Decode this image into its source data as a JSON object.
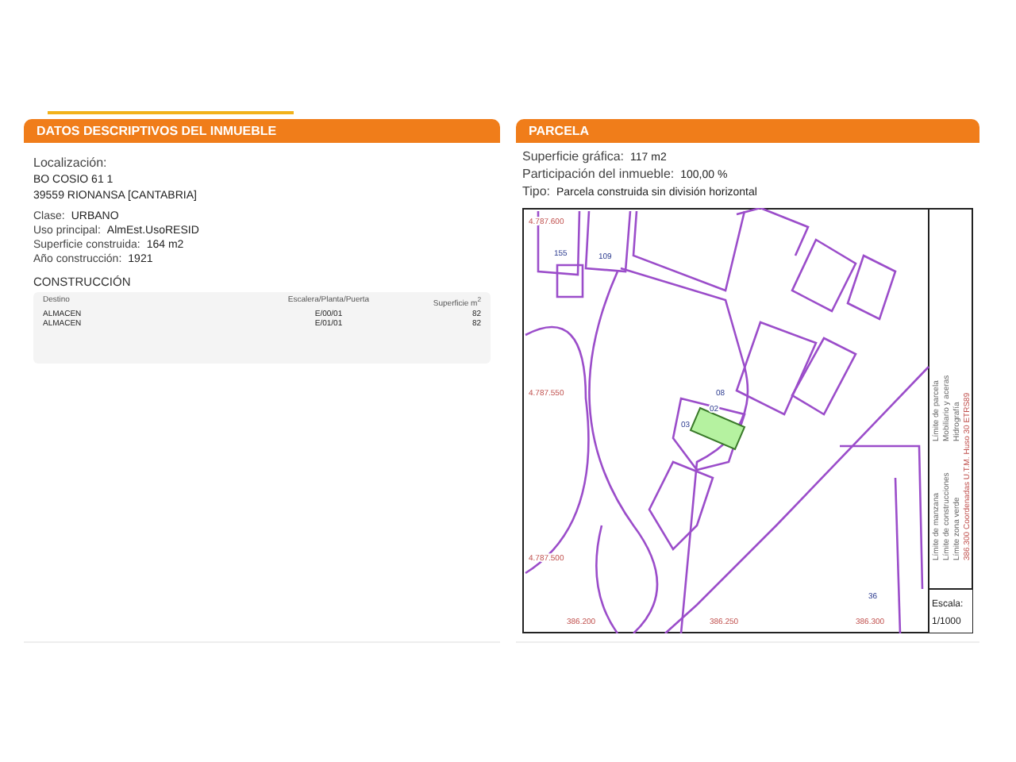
{
  "left_panel": {
    "title": "DATOS DESCRIPTIVOS DEL INMUEBLE",
    "location": {
      "label": "Localización:",
      "lines": [
        "BO COSIO 61 1",
        "39559 RIONANSA [CANTABRIA]"
      ]
    },
    "fields": [
      {
        "label": "Clase:",
        "value": "URBANO"
      },
      {
        "label": "Uso principal:",
        "value": "AlmEst.UsoRESID"
      },
      {
        "label": "Superficie construida:",
        "value": "164 m2"
      },
      {
        "label": "Año construcción:",
        "value": "1921"
      }
    ],
    "construction": {
      "title": "CONSTRUCCIÓN",
      "columns": [
        "Destino",
        "Escalera/Planta/Puerta",
        "Superficie m$^{2}$"
      ],
      "rows": [
        [
          "ALMACEN",
          "E/00/01",
          "82"
        ],
        [
          "ALMACEN",
          "E/01/01",
          "82"
        ]
      ]
    }
  },
  "right_panel": {
    "title": "PARCELA",
    "fields": [
      {
        "label": "Superficie gráfica:",
        "value": "117 m2"
      },
      {
        "label": "Participación del inmueble:",
        "value": "100,00 %"
      },
      {
        "label": "Tipo:",
        "value": "Parcela construida sin división horizontal"
      }
    ],
    "map": {
      "labels": [
        "4.787.600",
        "4.787.550",
        "4.787.500",
        "386.200",
        "386.250",
        "386.300",
        "155",
        "109",
        "08",
        "02",
        "03",
        "36"
      ],
      "legend": [
        "Límite de manzana",
        "Límite de parcela",
        "Límite de construcciones",
        "Mobiliario y aceras",
        "Límite zona verde",
        "Hidrografía"
      ],
      "coordinates_note": "386.300 Coordenadas U.T.M. Huso 30 ETRS89",
      "scale_label": "Escala:",
      "scale": "1/1000"
    }
  }
}
